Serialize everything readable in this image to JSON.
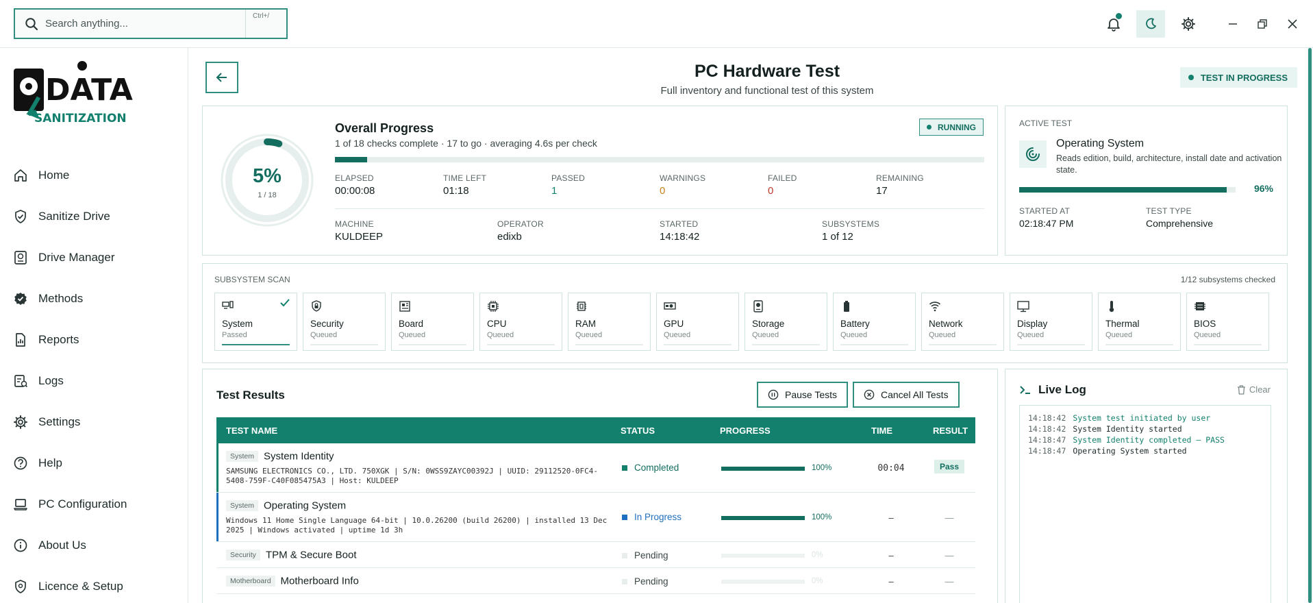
{
  "search": {
    "placeholder": "Search anything...",
    "shortcut": "Ctrl+/"
  },
  "logo": {
    "line1": "DATA",
    "line2": "SANITIZATION"
  },
  "sidebar": {
    "items": [
      {
        "label": "Home",
        "icon": "home-icon"
      },
      {
        "label": "Sanitize Drive",
        "icon": "shield-check-icon"
      },
      {
        "label": "Drive Manager",
        "icon": "drive-icon"
      },
      {
        "label": "Methods",
        "icon": "badge-check-icon"
      },
      {
        "label": "Reports",
        "icon": "report-icon"
      },
      {
        "label": "Logs",
        "icon": "logs-icon"
      },
      {
        "label": "Settings",
        "icon": "gear-icon"
      },
      {
        "label": "Help",
        "icon": "help-icon"
      },
      {
        "label": "PC Configuration",
        "icon": "laptop-icon"
      },
      {
        "label": "About Us",
        "icon": "info-icon"
      },
      {
        "label": "Licence & Setup",
        "icon": "license-icon"
      }
    ]
  },
  "header": {
    "title": "PC Hardware Test",
    "subtitle": "Full inventory and functional test of this system",
    "status": "TEST IN PROGRESS"
  },
  "overall": {
    "percent_text": "5%",
    "percent_value": 0.05,
    "count": "1 / 18",
    "title": "Overall Progress",
    "summary": "1 of 18 checks complete · 17 to go · averaging 4.6s per check",
    "badge": "RUNNING",
    "stats": [
      {
        "label": "ELAPSED",
        "value": "00:00:08"
      },
      {
        "label": "TIME LEFT",
        "value": "01:18"
      },
      {
        "label": "PASSED",
        "value": "1"
      },
      {
        "label": "WARNINGS",
        "value": "0"
      },
      {
        "label": "FAILED",
        "value": "0"
      },
      {
        "label": "REMAINING",
        "value": "17"
      }
    ],
    "meta": [
      {
        "label": "MACHINE",
        "value": "KULDEEP"
      },
      {
        "label": "OPERATOR",
        "value": "edixb"
      },
      {
        "label": "STARTED",
        "value": "14:18:42"
      },
      {
        "label": "SUBSYSTEMS",
        "value": "1 of 12"
      }
    ]
  },
  "active_test": {
    "label": "ACTIVE TEST",
    "name": "Operating System",
    "description": "Reads edition, build, architecture, install date and activation state.",
    "percent_text": "96%",
    "percent_value": 0.96,
    "started_label": "STARTED AT",
    "started_value": "02:18:47 PM",
    "type_label": "TEST TYPE",
    "type_value": "Comprehensive"
  },
  "subsystem_scan": {
    "label": "SUBSYSTEM SCAN",
    "count": "1/12 subsystems checked",
    "items": [
      {
        "name": "System",
        "status": "Passed",
        "icon": "system-icon"
      },
      {
        "name": "Security",
        "status": "Queued",
        "icon": "lock-shield-icon"
      },
      {
        "name": "Board",
        "status": "Queued",
        "icon": "board-icon"
      },
      {
        "name": "CPU",
        "status": "Queued",
        "icon": "cpu-icon"
      },
      {
        "name": "RAM",
        "status": "Queued",
        "icon": "ram-icon"
      },
      {
        "name": "GPU",
        "status": "Queued",
        "icon": "gpu-icon"
      },
      {
        "name": "Storage",
        "status": "Queued",
        "icon": "storage-icon"
      },
      {
        "name": "Battery",
        "status": "Queued",
        "icon": "battery-icon"
      },
      {
        "name": "Network",
        "status": "Queued",
        "icon": "wifi-icon"
      },
      {
        "name": "Display",
        "status": "Queued",
        "icon": "monitor-icon"
      },
      {
        "name": "Thermal",
        "status": "Queued",
        "icon": "thermometer-icon"
      },
      {
        "name": "BIOS",
        "status": "Queued",
        "icon": "chip-icon"
      }
    ]
  },
  "results": {
    "title": "Test Results",
    "pause_label": "Pause Tests",
    "cancel_label": "Cancel All Tests",
    "columns": [
      "TEST NAME",
      "STATUS",
      "PROGRESS",
      "TIME",
      "RESULT"
    ],
    "rows": [
      {
        "tag": "System",
        "name": "System Identity",
        "detail": "SAMSUNG ELECTRONICS CO., LTD. 750XGK | S/N: 0WSS9ZAYC00392J | UUID: 29112520-0FC4-5408-759F-C40F085475A3 | Host: KULDEEP",
        "status": "Completed",
        "progress_text": "100%",
        "progress_value": 1.0,
        "time": "00:04",
        "result": "Pass"
      },
      {
        "tag": "System",
        "name": "Operating System",
        "detail": "Windows 11 Home Single Language 64-bit | 10.0.26200 (build 26200) | installed 13 Dec 2025 | Windows activated | uptime 1d 3h",
        "status": "In Progress",
        "progress_text": "100%",
        "progress_value": 1.0,
        "time": "–",
        "result": "—"
      },
      {
        "tag": "Security",
        "name": "TPM & Secure Boot",
        "status": "Pending",
        "progress_text": "0%",
        "progress_value": 0,
        "time": "–",
        "result": "—"
      },
      {
        "tag": "Motherboard",
        "name": "Motherboard Info",
        "status": "Pending",
        "progress_text": "0%",
        "progress_value": 0,
        "time": "–",
        "result": "—"
      }
    ]
  },
  "live_log": {
    "title": "Live Log",
    "clear_label": "Clear",
    "lines": [
      {
        "time": "14:18:42",
        "message": "System test initiated by user",
        "kind": "ok"
      },
      {
        "time": "14:18:42",
        "message": "System Identity started",
        "kind": "info"
      },
      {
        "time": "14:18:47",
        "message": "System Identity completed — PASS",
        "kind": "ok"
      },
      {
        "time": "14:18:47",
        "message": "Operating System started",
        "kind": "info"
      }
    ]
  },
  "colors": {
    "accent": "#13806e",
    "accent_dark": "#136e60",
    "warning": "#c8841a",
    "danger": "#c0392b",
    "in_progress": "#1f6fc0"
  }
}
